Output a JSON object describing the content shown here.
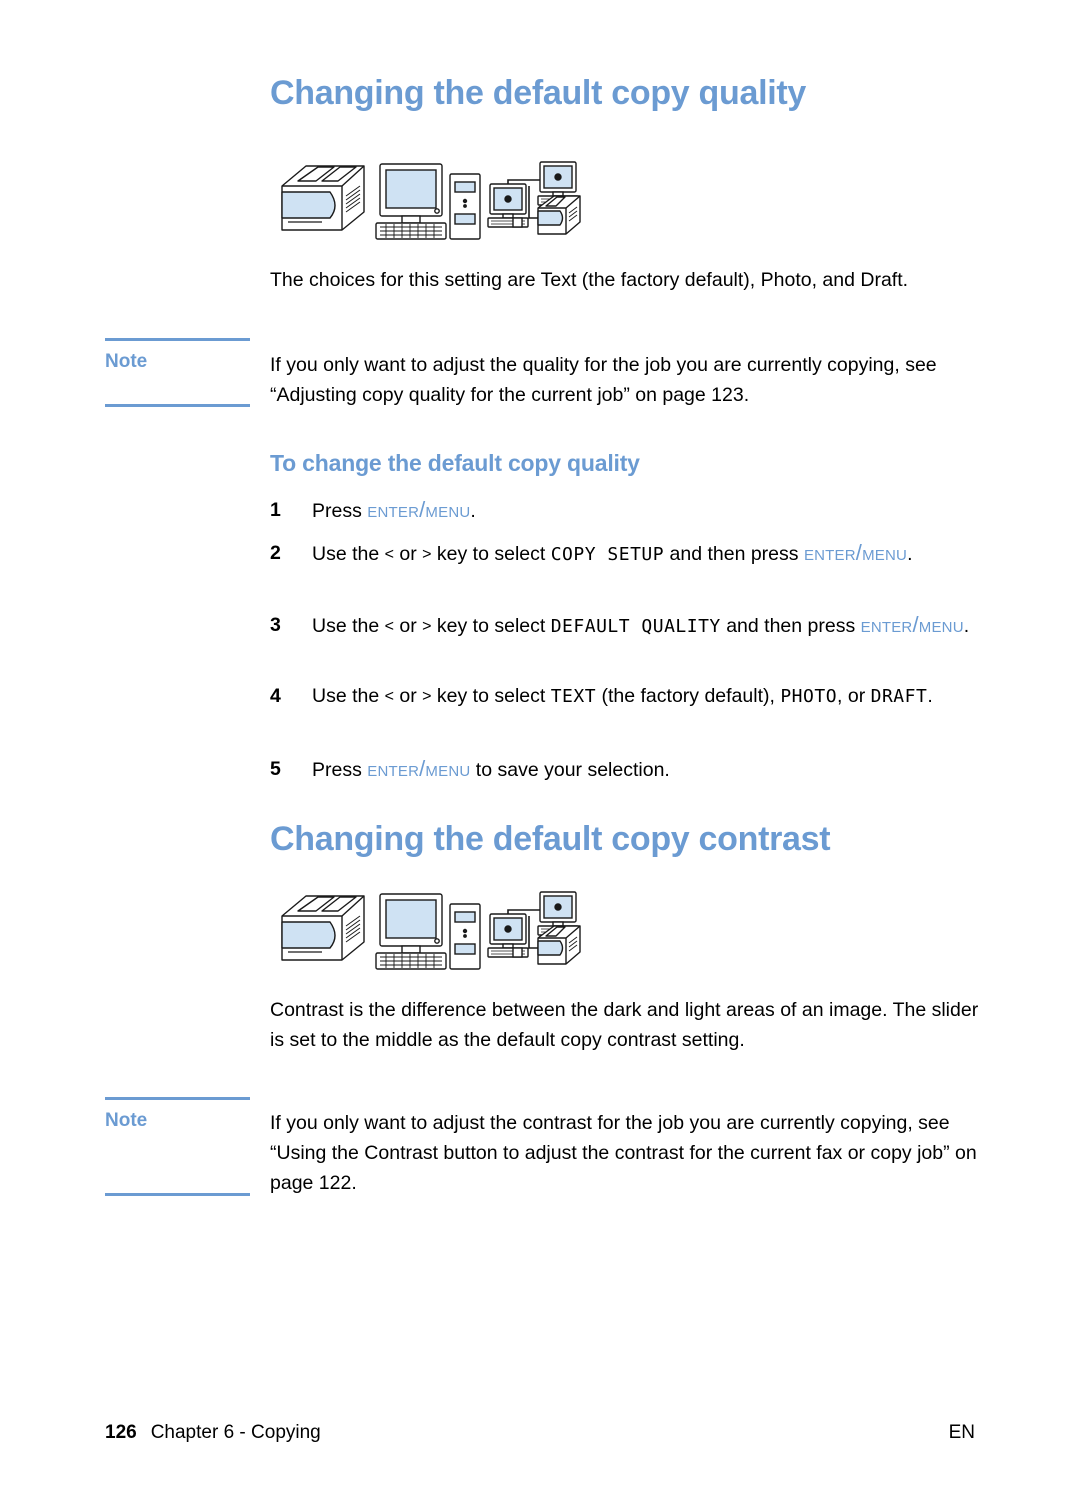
{
  "colors": {
    "accent_blue": "#6b9bd2",
    "icon_fill": "#cfe2f3",
    "text_black": "#000000"
  },
  "section1": {
    "heading": "Changing the default copy quality",
    "icons": [
      "printer-icon",
      "desktop-computer-icon",
      "network-printer-icon"
    ],
    "intro": "The choices for this setting are Text (the factory default), Photo, and Draft.",
    "note": {
      "label": "Note",
      "text": "If you only want to adjust the quality for the job you are currently copying, see “Adjusting copy quality for the current job” on page 123."
    },
    "subheading": "To change the default copy quality",
    "steps": [
      {
        "num": "1",
        "parts": [
          {
            "kind": "text",
            "value": "Press "
          },
          {
            "kind": "key",
            "value": "Enter/Menu"
          },
          {
            "kind": "text",
            "value": "."
          }
        ]
      },
      {
        "num": "2",
        "parts": [
          {
            "kind": "text",
            "value": "Use the "
          },
          {
            "kind": "arrow",
            "value": "<"
          },
          {
            "kind": "text",
            "value": " or "
          },
          {
            "kind": "arrow",
            "value": ">"
          },
          {
            "kind": "text",
            "value": " key to select "
          },
          {
            "kind": "lcd",
            "value": "COPY SETUP"
          },
          {
            "kind": "text",
            "value": " and then press "
          },
          {
            "kind": "key",
            "value": "Enter/Menu"
          },
          {
            "kind": "text",
            "value": "."
          }
        ]
      },
      {
        "num": "3",
        "parts": [
          {
            "kind": "text",
            "value": "Use the "
          },
          {
            "kind": "arrow",
            "value": "<"
          },
          {
            "kind": "text",
            "value": " or "
          },
          {
            "kind": "arrow",
            "value": ">"
          },
          {
            "kind": "text",
            "value": " key to select "
          },
          {
            "kind": "lcd",
            "value": "DEFAULT QUALITY"
          },
          {
            "kind": "text",
            "value": " and then press "
          },
          {
            "kind": "key",
            "value": "Enter/Menu"
          },
          {
            "kind": "text",
            "value": "."
          }
        ]
      },
      {
        "num": "4",
        "parts": [
          {
            "kind": "text",
            "value": "Use the "
          },
          {
            "kind": "arrow",
            "value": "<"
          },
          {
            "kind": "text",
            "value": " or "
          },
          {
            "kind": "arrow",
            "value": ">"
          },
          {
            "kind": "text",
            "value": " key to select "
          },
          {
            "kind": "lcd",
            "value": "TEXT"
          },
          {
            "kind": "text",
            "value": " (the factory default), "
          },
          {
            "kind": "lcd",
            "value": "PHOTO"
          },
          {
            "kind": "text",
            "value": ", or "
          },
          {
            "kind": "lcd",
            "value": "DRAFT"
          },
          {
            "kind": "text",
            "value": "."
          }
        ]
      },
      {
        "num": "5",
        "parts": [
          {
            "kind": "text",
            "value": "Press "
          },
          {
            "kind": "key",
            "value": "Enter/Menu"
          },
          {
            "kind": "text",
            "value": " to save your selection."
          }
        ]
      }
    ]
  },
  "section2": {
    "heading": "Changing the default copy contrast",
    "icons": [
      "printer-icon",
      "desktop-computer-icon",
      "network-printer-icon"
    ],
    "intro": "Contrast is the difference between the dark and light areas of an image. The slider is set to the middle as the default copy contrast setting.",
    "note": {
      "label": "Note",
      "text": "If you only want to adjust the contrast for the job you are currently copying, see “Using the Contrast button to adjust the contrast for the current fax or copy job” on page 122."
    }
  },
  "footer": {
    "page_number": "126",
    "chapter": "Chapter 6 - Copying",
    "language": "EN"
  }
}
